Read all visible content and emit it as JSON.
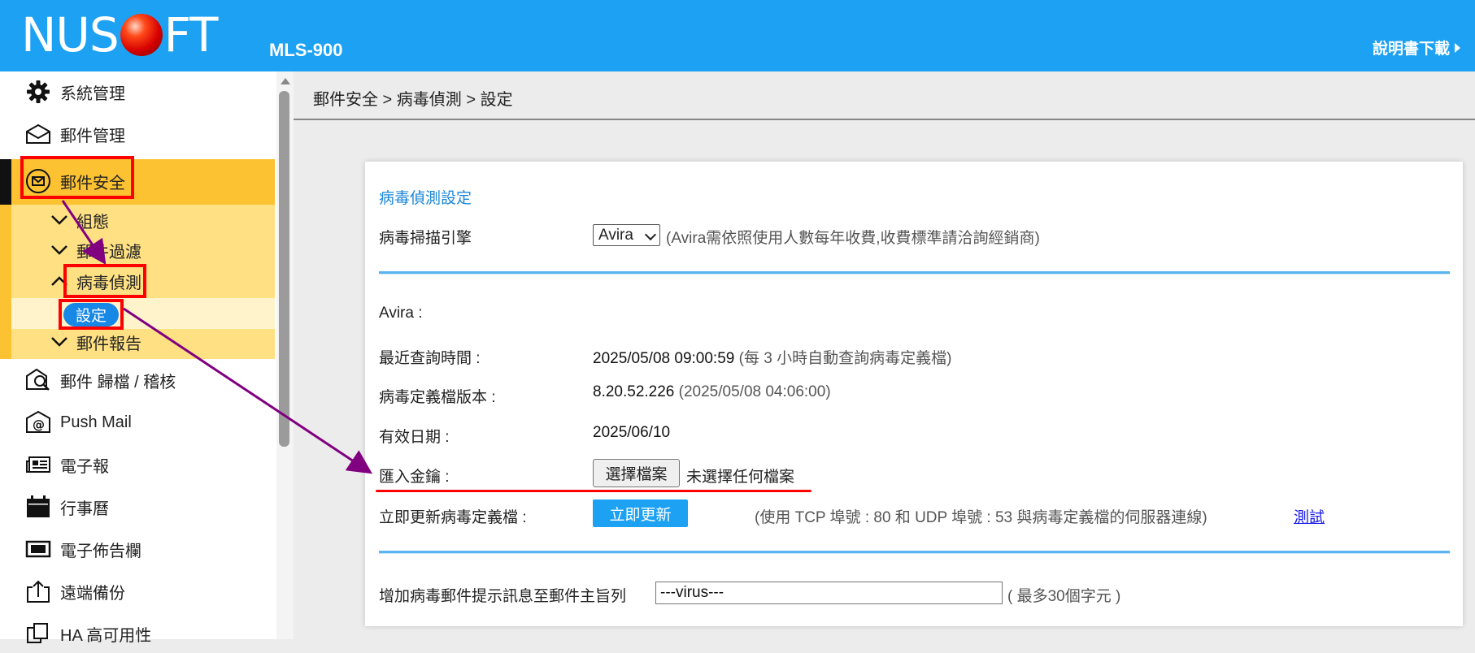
{
  "header": {
    "logo_left": "NUS",
    "logo_right": "FT",
    "model": "MLS-900",
    "manual_link": "說明書下載"
  },
  "sidebar": {
    "items": [
      {
        "label": "系統管理",
        "icon": "gear-icon"
      },
      {
        "label": "郵件管理",
        "icon": "envelope-icon"
      },
      {
        "label": "郵件安全",
        "icon": "mail-security-icon"
      },
      {
        "label": "郵件 歸檔 / 稽核",
        "icon": "mail-search-icon"
      },
      {
        "label": "Push Mail",
        "icon": "at-mail-icon"
      },
      {
        "label": "電子報",
        "icon": "newspaper-icon"
      },
      {
        "label": "行事曆",
        "icon": "calendar-icon"
      },
      {
        "label": "電子佈告欄",
        "icon": "board-icon"
      },
      {
        "label": "遠端備份",
        "icon": "upload-box-icon"
      },
      {
        "label": "HA 高可用性",
        "icon": "ha-icon"
      }
    ],
    "security_sub": [
      {
        "label": "組態",
        "icon": "chevron-down-icon"
      },
      {
        "label": "郵件過濾",
        "icon": "chevron-down-icon"
      },
      {
        "label": "病毒偵測",
        "icon": "chevron-up-icon"
      },
      {
        "label": "設定",
        "icon": ""
      },
      {
        "label": "郵件報告",
        "icon": "chevron-down-icon"
      }
    ]
  },
  "breadcrumb": "郵件安全 > 病毒偵測 > 設定",
  "form": {
    "section_title": "病毒偵測設定",
    "engine_label": "病毒掃描引擎",
    "engine_value": "Avira",
    "engine_note": "(Avira需依照使用人數每年收費,收費標準請洽詢經銷商)",
    "vendor_header": "Avira :",
    "last_query_label": "最近查詢時間 :",
    "last_query_value": "2025/05/08 09:00:59",
    "last_query_note": "(每 3 小時自動查詢病毒定義檔)",
    "def_version_label": "病毒定義檔版本 :",
    "def_version_value": "8.20.52.226",
    "def_version_note": "(2025/05/08 04:06:00)",
    "expiry_label": "有效日期 :",
    "expiry_value": "2025/06/10",
    "import_key_label": "匯入金鑰 :",
    "choose_file_button": "選擇檔案",
    "file_status": "未選擇任何檔案",
    "update_label": "立即更新病毒定義檔 :",
    "update_button": "立即更新",
    "update_note": "(使用 TCP 埠號 : 80 和 UDP 埠號 : 53 與病毒定義檔的伺服器連線)",
    "test_link": "測試",
    "subject_label": "增加病毒郵件提示訊息至郵件主旨列",
    "subject_value": "---virus---",
    "subject_note": "( 最多30個字元 )"
  },
  "colors": {
    "header_blue": "#1da1f2",
    "annotation_red": "#ff0000",
    "annotation_purple": "#800080",
    "menu_yellow": "#fdc231"
  }
}
